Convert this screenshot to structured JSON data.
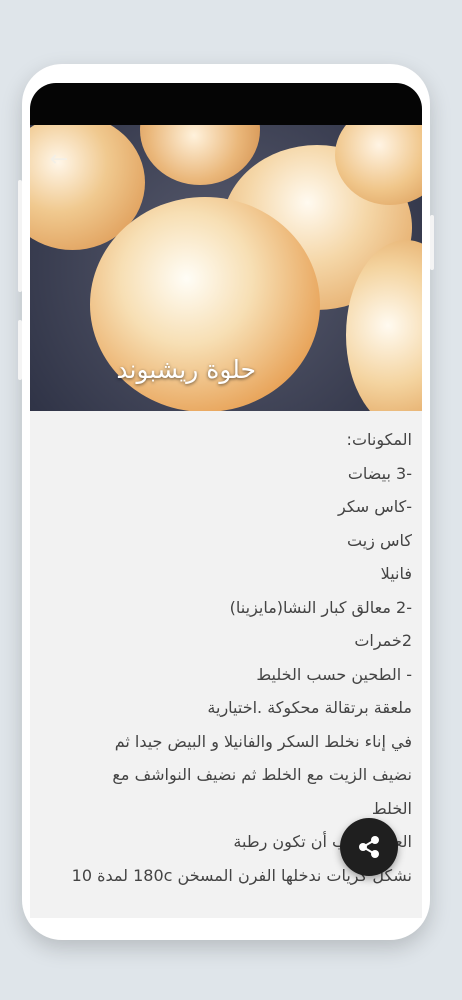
{
  "header": {
    "title": "حلوة ريشبوند",
    "back_icon": "arrow-left-icon"
  },
  "recipe": {
    "lines": [
      "المكونات:",
      "-3 بيضات",
      "-كاس سكر",
      "كاس زيت",
      "فانيلا",
      "-2 معالق كبار النشا(مايزينا)",
      "2خمرات",
      "- الطحين حسب الخليط",
      "ملعقة برتقالة محكوكة .اختيارية",
      "في إناء نخلط السكر والفانيلا و البيض جيدا ثم",
      "نضيف الزيت مع الخلط ثم نضيف النواشف مع",
      "الخلط",
      "العجين يجب أن تكون رطبة",
      "نشكل كريات ندخلها الفرن المسخن 180c لمدة 10"
    ]
  },
  "fab": {
    "icon": "share-icon"
  },
  "colors": {
    "background": "#dfe5ea",
    "content_bg": "#f2f2f2",
    "text": "#444444",
    "fab": "#1f1f1f"
  }
}
